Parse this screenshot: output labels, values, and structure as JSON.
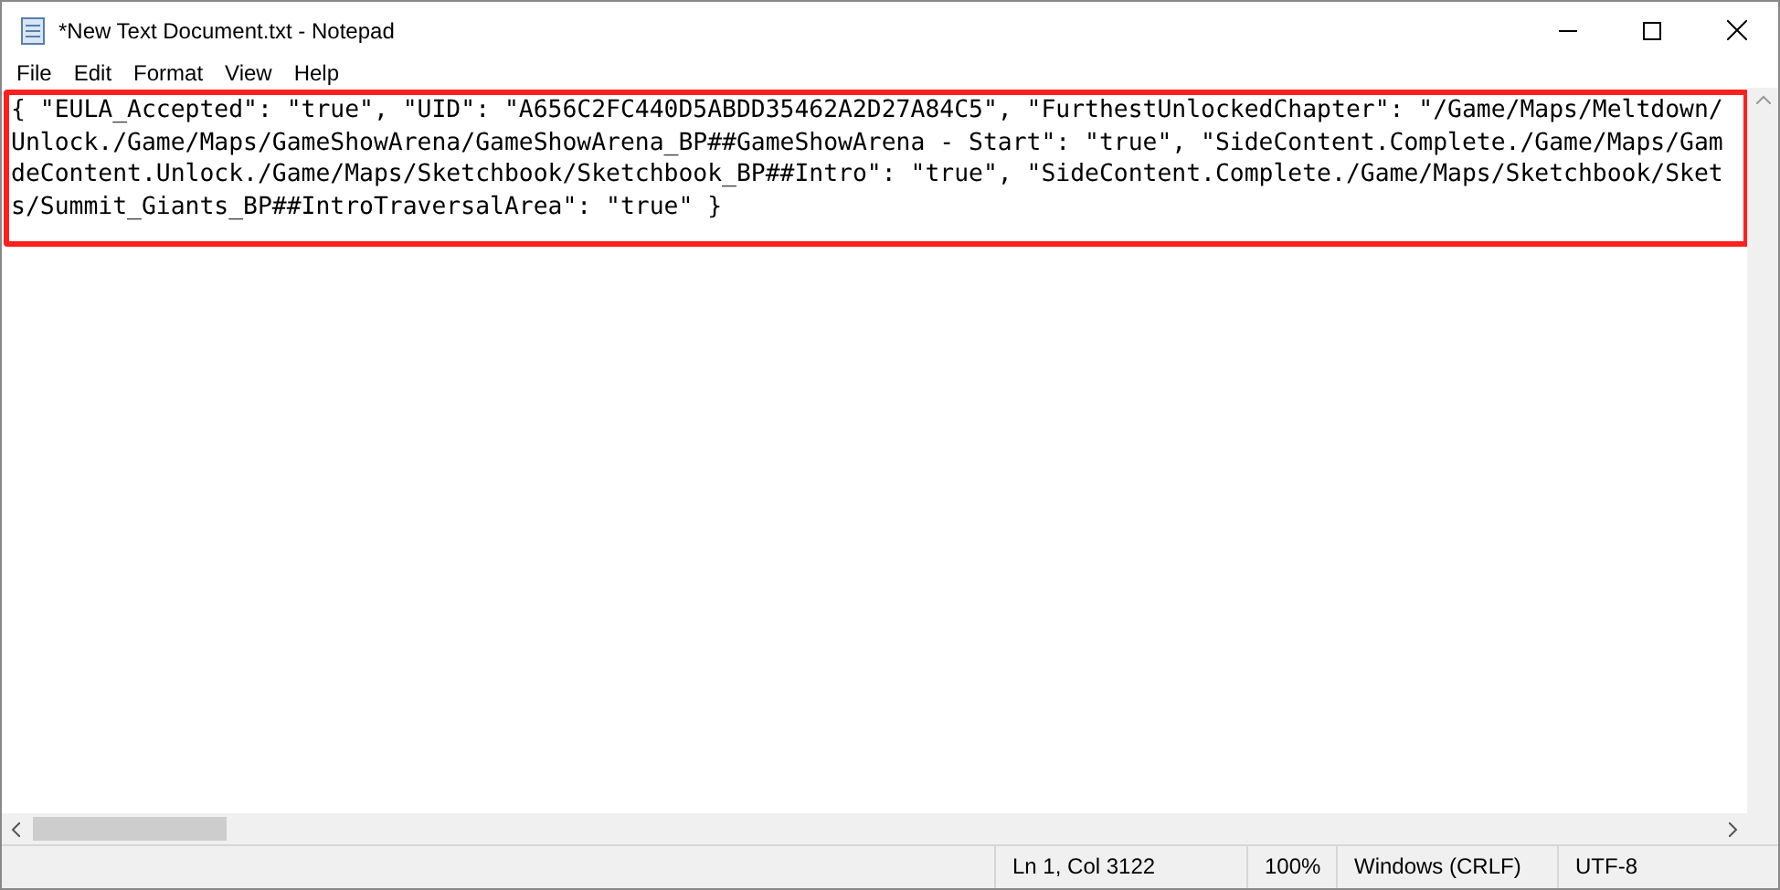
{
  "window": {
    "title": "*New Text Document.txt - Notepad"
  },
  "menu": [
    {
      "label": "File"
    },
    {
      "label": "Edit"
    },
    {
      "label": "Format"
    },
    {
      "label": "View"
    },
    {
      "label": "Help"
    }
  ],
  "editor": {
    "lines": [
      "{ \"EULA_Accepted\": \"true\", \"UID\": \"A656C2FC440D5ABDD35462A2D27A84C5\", \"FurthestUnlockedChapter\": \"/Game/Maps/Meltdown/",
      "Unlock./Game/Maps/GameShowArena/GameShowArena_BP##GameShowArena - Start\": \"true\", \"SideContent.Complete./Game/Maps/Gam",
      "deContent.Unlock./Game/Maps/Sketchbook/Sketchbook_BP##Intro\": \"true\", \"SideContent.Complete./Game/Maps/Sketchbook/Sket",
      "s/Summit_Giants_BP##IntroTraversalArea\": \"true\" }"
    ]
  },
  "status_bar": [
    "Ln 1, Col 3122",
    "100%",
    "Windows (CRLF)",
    "UTF-8"
  ]
}
